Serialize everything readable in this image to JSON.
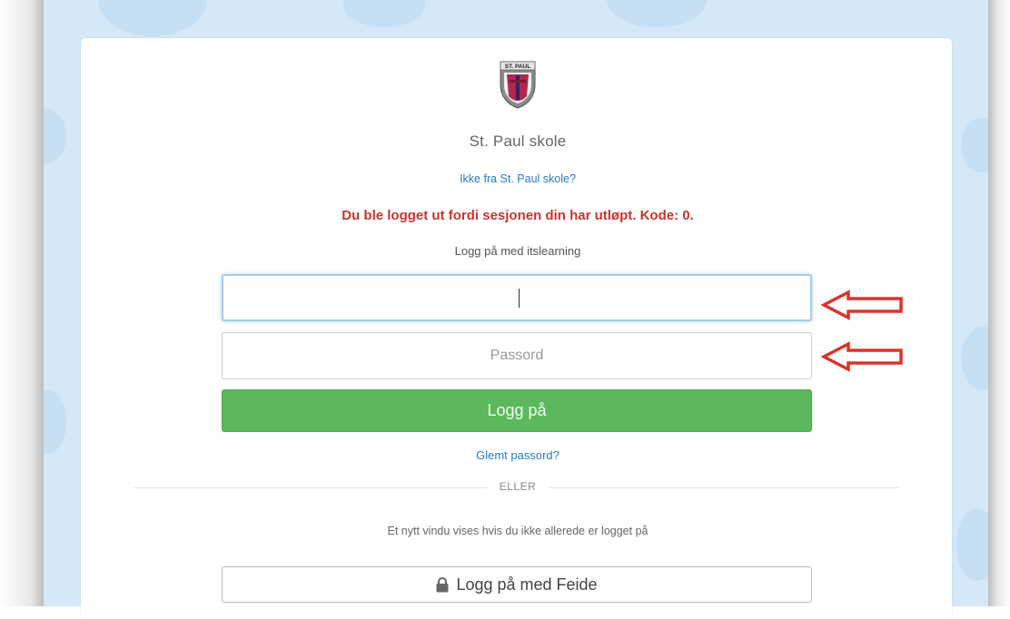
{
  "school": {
    "name": "St. Paul skole",
    "crest_text": "ST. PAUL",
    "not_from_link": "Ikke fra St. Paul skole?"
  },
  "error": {
    "message": "Du ble logget ut fordi sesjonen din har utløpt. Kode: 0."
  },
  "login": {
    "heading": "Logg på med itslearning",
    "username_value": "",
    "username_placeholder": "",
    "password_placeholder": "Passord",
    "submit_label": "Logg på",
    "forgot_link": "Glemt passord?"
  },
  "divider": {
    "label": "ELLER"
  },
  "alternative": {
    "info_text": "Et nytt vindu vises hvis du ikke allerede er logget på",
    "feide_label": "Logg på med Feide",
    "feide_icon": "lock-icon"
  },
  "annotations": {
    "arrow_color": "#d9342b",
    "arrow_icon": "left-arrow-icon"
  },
  "colors": {
    "background": "#d4e8f7",
    "link": "#2a7bbf",
    "error": "#c9342f",
    "primary_button": "#5cb85c"
  }
}
